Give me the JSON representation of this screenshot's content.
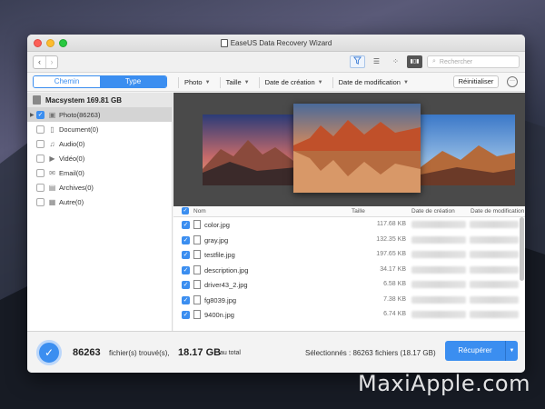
{
  "window": {
    "title": "EaseUS Data Recovery Wizard"
  },
  "toolbar": {
    "back_label": "‹",
    "forward_label": "›",
    "search_placeholder": "Rechercher",
    "view_modes": [
      "filter",
      "list",
      "grid",
      "filmstrip"
    ]
  },
  "filterbar": {
    "tabs": [
      {
        "label": "Chemin",
        "active": false
      },
      {
        "label": "Type",
        "active": true
      }
    ],
    "filters": [
      "Photo",
      "Taille",
      "Date de création",
      "Date de modification"
    ],
    "reset_label": "Réinitialiser",
    "more_label": "···"
  },
  "sidebar": {
    "drive_label": "Macsystem 169.81 GB",
    "items": [
      {
        "label": "Photo(86263)",
        "checked": true,
        "selected": true,
        "icon": "photo-icon"
      },
      {
        "label": "Document(0)",
        "checked": false,
        "selected": false,
        "icon": "document-icon"
      },
      {
        "label": "Audio(0)",
        "checked": false,
        "selected": false,
        "icon": "music-icon"
      },
      {
        "label": "Vidéo(0)",
        "checked": false,
        "selected": false,
        "icon": "video-icon"
      },
      {
        "label": "Email(0)",
        "checked": false,
        "selected": false,
        "icon": "email-icon"
      },
      {
        "label": "Archives(0)",
        "checked": false,
        "selected": false,
        "icon": "archive-icon"
      },
      {
        "label": "Autre(0)",
        "checked": false,
        "selected": false,
        "icon": "other-icon"
      }
    ]
  },
  "table": {
    "columns": [
      "Nom",
      "Taille",
      "Date de création",
      "Date de modification"
    ],
    "rows": [
      {
        "name": "color.jpg",
        "size": "117.68 KB"
      },
      {
        "name": "gray.jpg",
        "size": "132.35 KB"
      },
      {
        "name": "testfile.jpg",
        "size": "197.65 KB"
      },
      {
        "name": "description.jpg",
        "size": "34.17 KB"
      },
      {
        "name": "driver43_2.jpg",
        "size": "6.58 KB"
      },
      {
        "name": "fg8039.jpg",
        "size": "7.38 KB"
      },
      {
        "name": "9400n.jpg",
        "size": "6.74 KB"
      }
    ]
  },
  "footer": {
    "count": "86263",
    "found_label": "fichier(s) trouvé(s),",
    "total_size": "18.17 GB",
    "total_label": "au total",
    "selected_label": "Sélectionnés : 86263 fichiers (18.17 GB)",
    "recover_label": "Récupérer"
  },
  "watermark": "MaxiApple.com",
  "colors": {
    "accent": "#3b8ef0"
  }
}
